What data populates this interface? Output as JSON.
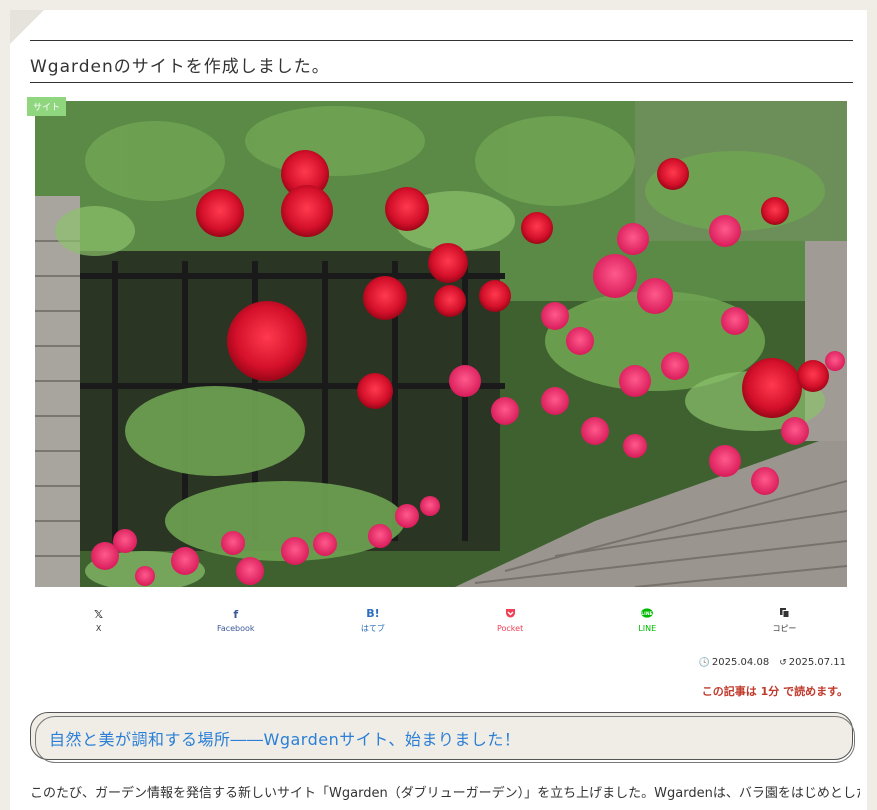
{
  "article": {
    "title": "Wgardenのサイトを作成しました。",
    "category": "サイト",
    "published_date": "2025.04.08",
    "updated_date": "2025.07.11",
    "read_time": "この記事は 1分 で読めます。",
    "heading": "自然と美が調和する場所――Wgardenサイト、始まりました！",
    "intro": "このたび、ガーデン情報を発信する新しいサイト「Wgarden（ダブリューガーデン）」を立ち上げました。Wgardenは、バラ園をはじめとした"
  },
  "share": [
    {
      "label": "X",
      "icon": "X",
      "color": "#333333"
    },
    {
      "label": "Facebook",
      "icon": "f",
      "color": "#3b5998"
    },
    {
      "label": "はてブ",
      "icon": "B!",
      "color": "#2c6ebd"
    },
    {
      "label": "Pocket",
      "icon": "◘",
      "color": "#ef4056"
    },
    {
      "label": "LINE",
      "icon": "◉",
      "color": "#00b900"
    },
    {
      "label": "コピー",
      "icon": "⧉",
      "color": "#333333"
    }
  ],
  "icons": {
    "published": "clock-icon",
    "updated": "history-icon"
  },
  "colors": {
    "accent_heading": "#2b7fd6",
    "read_time": "#c0392b",
    "category_badge": "#8fd67f",
    "background": "#efede6"
  }
}
